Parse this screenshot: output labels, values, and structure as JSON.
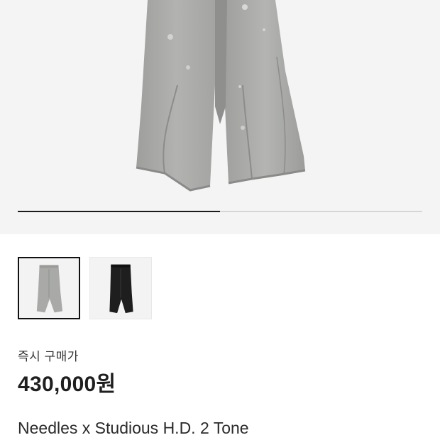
{
  "product": {
    "images": [
      {
        "icon": "gray-sweatpants-photo",
        "selected": true
      },
      {
        "icon": "black-sweatpants-photo",
        "selected": false
      }
    ],
    "image_progress": 0.5,
    "price_label": "즉시 구매가",
    "price": "430,000원",
    "title": "Needles x Studious H.D. 2 Tone"
  },
  "colors": {
    "progress_fill": "#1a1a1a",
    "progress_track": "#d6d6d6",
    "pants_gray": "#a9aaa8",
    "pants_black": "#1e1e1e"
  }
}
